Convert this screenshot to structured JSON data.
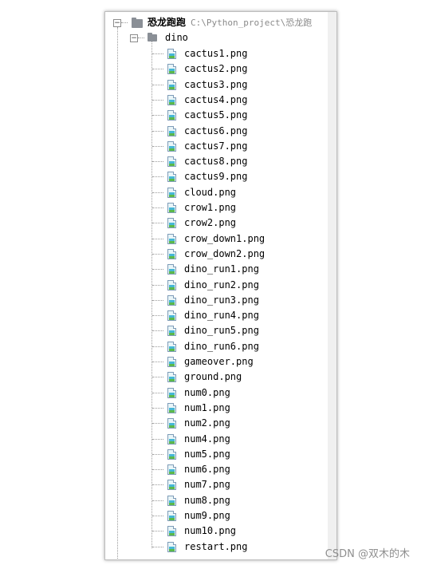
{
  "project": {
    "name": "恐龙跑跑",
    "path": "C:\\Python_project\\恐龙跑"
  },
  "folder": {
    "name": "dino"
  },
  "files": [
    "cactus1.png",
    "cactus2.png",
    "cactus3.png",
    "cactus4.png",
    "cactus5.png",
    "cactus6.png",
    "cactus7.png",
    "cactus8.png",
    "cactus9.png",
    "cloud.png",
    "crow1.png",
    "crow2.png",
    "crow_down1.png",
    "crow_down2.png",
    "dino_run1.png",
    "dino_run2.png",
    "dino_run3.png",
    "dino_run4.png",
    "dino_run5.png",
    "dino_run6.png",
    "gameover.png",
    "ground.png",
    "num0.png",
    "num1.png",
    "num2.png",
    "num4.png",
    "num5.png",
    "num6.png",
    "num7.png",
    "num8.png",
    "num9.png",
    "num10.png",
    "restart.png"
  ],
  "icons": {
    "project": "folder-icon",
    "folder": "folder-icon",
    "file": "image-file-icon",
    "toggle": "collapse-toggle-icon"
  },
  "watermark": "CSDN @双木的木",
  "colors": {
    "guide_line": "#9a9a9a",
    "folder_icon": "#8a8f96",
    "path_text": "#8a8a8a"
  }
}
